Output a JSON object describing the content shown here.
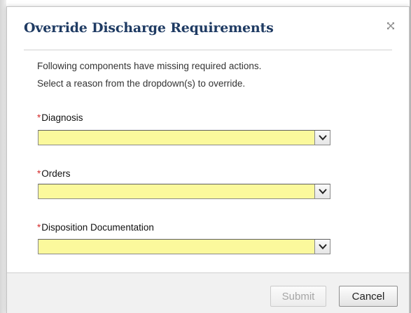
{
  "dialog": {
    "title": "Override Discharge Requirements",
    "close_icon": "close-icon",
    "instructions": [
      "Following components have missing required actions.",
      "Select a reason from the dropdown(s) to override."
    ],
    "fields": [
      {
        "label": "Diagnosis",
        "required_marker": "*",
        "value": ""
      },
      {
        "label": "Orders",
        "required_marker": "*",
        "value": ""
      },
      {
        "label": "Disposition Documentation",
        "required_marker": "*",
        "value": ""
      }
    ],
    "buttons": {
      "submit_label": "Submit",
      "cancel_label": "Cancel"
    }
  },
  "colors": {
    "title": "#1f3b63",
    "required_star": "#d42b2b",
    "select_background": "#fbf99c",
    "footer_background": "#f1f1f1"
  }
}
